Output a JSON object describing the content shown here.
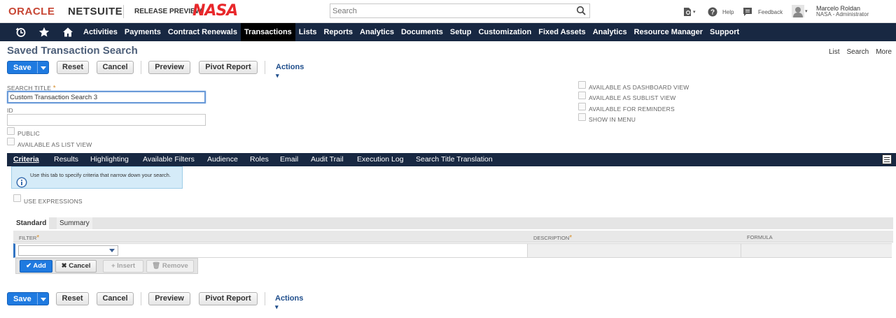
{
  "header": {
    "logo_oracle": "ORACLE",
    "logo_netsuite": "NETSUITE",
    "release_preview": "RELEASE PREVIEW",
    "company_logo": "NASA",
    "search_placeholder": "Search",
    "help_label": "Help",
    "feedback_label": "Feedback",
    "user_name": "Marcelo Roldan",
    "user_role": "NASA - Administrator"
  },
  "nav": {
    "items": [
      "Activities",
      "Payments",
      "Contract Renewals",
      "Transactions",
      "Lists",
      "Reports",
      "Analytics",
      "Documents",
      "Setup",
      "Customization",
      "Fixed Assets",
      "Analytics",
      "Resource Manager",
      "Support"
    ],
    "active_index": 3
  },
  "page": {
    "title": "Saved Transaction Search",
    "links": [
      "List",
      "Search",
      "More"
    ]
  },
  "buttons": {
    "save": "Save",
    "reset": "Reset",
    "cancel": "Cancel",
    "preview": "Preview",
    "pivot_report": "Pivot Report",
    "actions": "Actions"
  },
  "form": {
    "search_title_label": "SEARCH TITLE",
    "search_title_value": "Custom Transaction Search 3",
    "id_label": "ID",
    "id_value": "",
    "public_label": "PUBLIC",
    "available_list_view_label": "AVAILABLE AS LIST VIEW",
    "available_dashboard_label": "AVAILABLE AS DASHBOARD VIEW",
    "available_sublist_label": "AVAILABLE AS SUBLIST VIEW",
    "available_reminders_label": "AVAILABLE FOR REMINDERS",
    "show_in_menu_label": "SHOW IN MENU"
  },
  "tabs": {
    "items": [
      "Criteria",
      "Results",
      "Highlighting",
      "Available Filters",
      "Audience",
      "Roles",
      "Email",
      "Audit Trail",
      "Execution Log",
      "Search Title Translation"
    ],
    "active_index": 0
  },
  "tooltip": {
    "text": "Use this tab to specify criteria that narrow down your search."
  },
  "criteria": {
    "use_expressions_label": "USE EXPRESSIONS",
    "subtabs": [
      "Standard",
      "Summary"
    ],
    "columns": [
      "FILTER",
      "DESCRIPTION",
      "FORMULA"
    ],
    "add_label": "Add",
    "cancel_label": "Cancel",
    "insert_label": "Insert",
    "remove_label": "Remove"
  }
}
